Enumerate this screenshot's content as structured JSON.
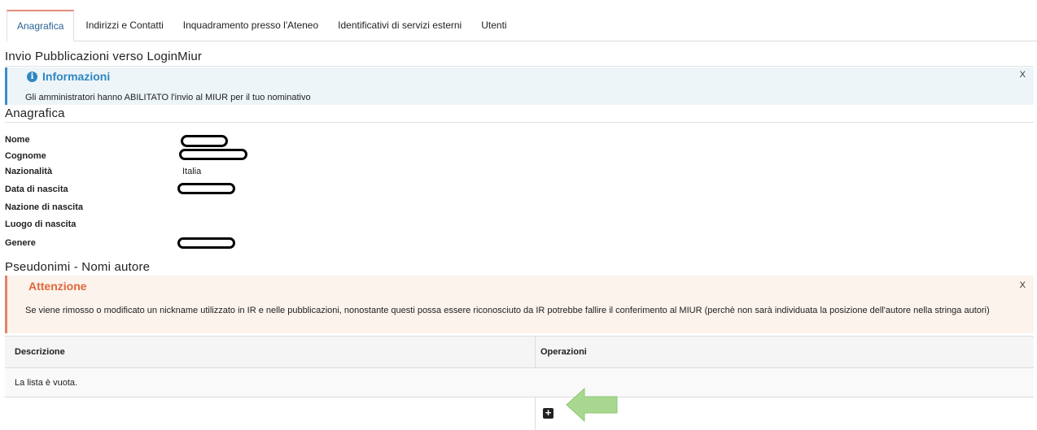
{
  "tabs": [
    {
      "label": "Anagrafica",
      "active": true
    },
    {
      "label": "Indirizzi e Contatti"
    },
    {
      "label": "Inquadramento presso l'Ateneo"
    },
    {
      "label": "Identificativi di servizi esterni"
    },
    {
      "label": "Utenti"
    }
  ],
  "section_invio": {
    "title": "Invio Pubblicazioni verso LoginMiur"
  },
  "info_alert": {
    "title": "Informazioni",
    "icon": "info-circle-icon",
    "message": "Gli amministratori hanno ABILITATO l'invio al MIUR per il tuo nominativo",
    "close": "X"
  },
  "section_anagrafica": {
    "title": "Anagrafica"
  },
  "fields": [
    {
      "label": "Nome",
      "value": "",
      "redacted": true
    },
    {
      "label": "Cognome",
      "value": "",
      "redacted": true
    },
    {
      "label": "Nazionalità",
      "value": "Italia"
    },
    {
      "label": "Data di nascita",
      "value": "",
      "redacted": true
    },
    {
      "label": "Nazione di nascita",
      "value": ""
    },
    {
      "label": "Luogo di nascita",
      "value": ""
    },
    {
      "label": "Genere",
      "value": "",
      "redacted": true
    }
  ],
  "section_pseudonimi": {
    "title": "Pseudonimi - Nomi autore"
  },
  "warning_alert": {
    "title": "Attenzione",
    "message": "Se viene rimosso o modificato un nickname utilizzato in IR e nelle pubblicazioni, nonostante questi possa essere riconosciuto da IR potrebbe fallire il conferimento al MIUR (perchè non sarà individuata la posizione dell'autore nella stringa autori)",
    "close": "X"
  },
  "table": {
    "headers": [
      "Descrizione",
      "Operazioni"
    ],
    "empty_text": "La lista è vuota.",
    "add_icon": "plus-square-icon"
  },
  "colors": {
    "accent": "#2e86c1",
    "warning": "#e0673d",
    "arrow": "#a8d890"
  }
}
